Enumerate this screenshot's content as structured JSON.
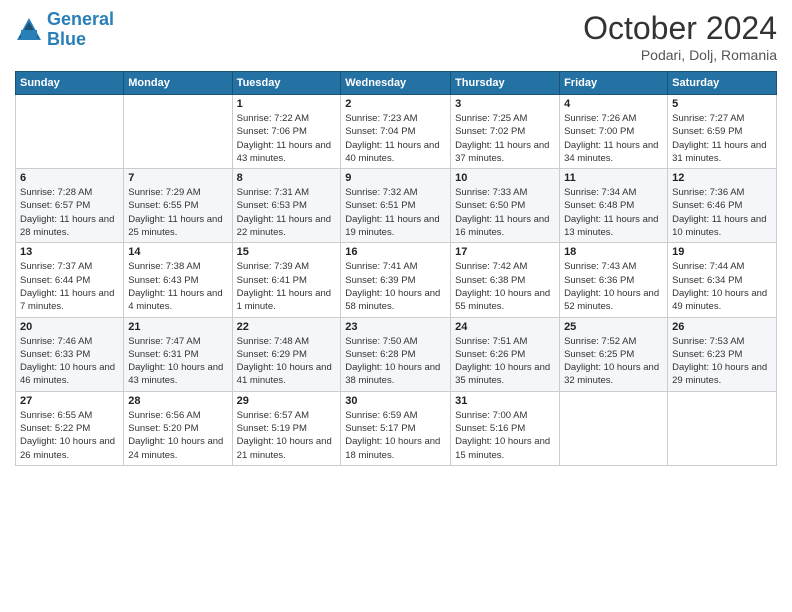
{
  "header": {
    "logo_line1": "General",
    "logo_line2": "Blue",
    "month_title": "October 2024",
    "location": "Podari, Dolj, Romania"
  },
  "days_of_week": [
    "Sunday",
    "Monday",
    "Tuesday",
    "Wednesday",
    "Thursday",
    "Friday",
    "Saturday"
  ],
  "weeks": [
    [
      {
        "num": "",
        "info": ""
      },
      {
        "num": "",
        "info": ""
      },
      {
        "num": "1",
        "info": "Sunrise: 7:22 AM\nSunset: 7:06 PM\nDaylight: 11 hours and 43 minutes."
      },
      {
        "num": "2",
        "info": "Sunrise: 7:23 AM\nSunset: 7:04 PM\nDaylight: 11 hours and 40 minutes."
      },
      {
        "num": "3",
        "info": "Sunrise: 7:25 AM\nSunset: 7:02 PM\nDaylight: 11 hours and 37 minutes."
      },
      {
        "num": "4",
        "info": "Sunrise: 7:26 AM\nSunset: 7:00 PM\nDaylight: 11 hours and 34 minutes."
      },
      {
        "num": "5",
        "info": "Sunrise: 7:27 AM\nSunset: 6:59 PM\nDaylight: 11 hours and 31 minutes."
      }
    ],
    [
      {
        "num": "6",
        "info": "Sunrise: 7:28 AM\nSunset: 6:57 PM\nDaylight: 11 hours and 28 minutes."
      },
      {
        "num": "7",
        "info": "Sunrise: 7:29 AM\nSunset: 6:55 PM\nDaylight: 11 hours and 25 minutes."
      },
      {
        "num": "8",
        "info": "Sunrise: 7:31 AM\nSunset: 6:53 PM\nDaylight: 11 hours and 22 minutes."
      },
      {
        "num": "9",
        "info": "Sunrise: 7:32 AM\nSunset: 6:51 PM\nDaylight: 11 hours and 19 minutes."
      },
      {
        "num": "10",
        "info": "Sunrise: 7:33 AM\nSunset: 6:50 PM\nDaylight: 11 hours and 16 minutes."
      },
      {
        "num": "11",
        "info": "Sunrise: 7:34 AM\nSunset: 6:48 PM\nDaylight: 11 hours and 13 minutes."
      },
      {
        "num": "12",
        "info": "Sunrise: 7:36 AM\nSunset: 6:46 PM\nDaylight: 11 hours and 10 minutes."
      }
    ],
    [
      {
        "num": "13",
        "info": "Sunrise: 7:37 AM\nSunset: 6:44 PM\nDaylight: 11 hours and 7 minutes."
      },
      {
        "num": "14",
        "info": "Sunrise: 7:38 AM\nSunset: 6:43 PM\nDaylight: 11 hours and 4 minutes."
      },
      {
        "num": "15",
        "info": "Sunrise: 7:39 AM\nSunset: 6:41 PM\nDaylight: 11 hours and 1 minute."
      },
      {
        "num": "16",
        "info": "Sunrise: 7:41 AM\nSunset: 6:39 PM\nDaylight: 10 hours and 58 minutes."
      },
      {
        "num": "17",
        "info": "Sunrise: 7:42 AM\nSunset: 6:38 PM\nDaylight: 10 hours and 55 minutes."
      },
      {
        "num": "18",
        "info": "Sunrise: 7:43 AM\nSunset: 6:36 PM\nDaylight: 10 hours and 52 minutes."
      },
      {
        "num": "19",
        "info": "Sunrise: 7:44 AM\nSunset: 6:34 PM\nDaylight: 10 hours and 49 minutes."
      }
    ],
    [
      {
        "num": "20",
        "info": "Sunrise: 7:46 AM\nSunset: 6:33 PM\nDaylight: 10 hours and 46 minutes."
      },
      {
        "num": "21",
        "info": "Sunrise: 7:47 AM\nSunset: 6:31 PM\nDaylight: 10 hours and 43 minutes."
      },
      {
        "num": "22",
        "info": "Sunrise: 7:48 AM\nSunset: 6:29 PM\nDaylight: 10 hours and 41 minutes."
      },
      {
        "num": "23",
        "info": "Sunrise: 7:50 AM\nSunset: 6:28 PM\nDaylight: 10 hours and 38 minutes."
      },
      {
        "num": "24",
        "info": "Sunrise: 7:51 AM\nSunset: 6:26 PM\nDaylight: 10 hours and 35 minutes."
      },
      {
        "num": "25",
        "info": "Sunrise: 7:52 AM\nSunset: 6:25 PM\nDaylight: 10 hours and 32 minutes."
      },
      {
        "num": "26",
        "info": "Sunrise: 7:53 AM\nSunset: 6:23 PM\nDaylight: 10 hours and 29 minutes."
      }
    ],
    [
      {
        "num": "27",
        "info": "Sunrise: 6:55 AM\nSunset: 5:22 PM\nDaylight: 10 hours and 26 minutes."
      },
      {
        "num": "28",
        "info": "Sunrise: 6:56 AM\nSunset: 5:20 PM\nDaylight: 10 hours and 24 minutes."
      },
      {
        "num": "29",
        "info": "Sunrise: 6:57 AM\nSunset: 5:19 PM\nDaylight: 10 hours and 21 minutes."
      },
      {
        "num": "30",
        "info": "Sunrise: 6:59 AM\nSunset: 5:17 PM\nDaylight: 10 hours and 18 minutes."
      },
      {
        "num": "31",
        "info": "Sunrise: 7:00 AM\nSunset: 5:16 PM\nDaylight: 10 hours and 15 minutes."
      },
      {
        "num": "",
        "info": ""
      },
      {
        "num": "",
        "info": ""
      }
    ]
  ]
}
